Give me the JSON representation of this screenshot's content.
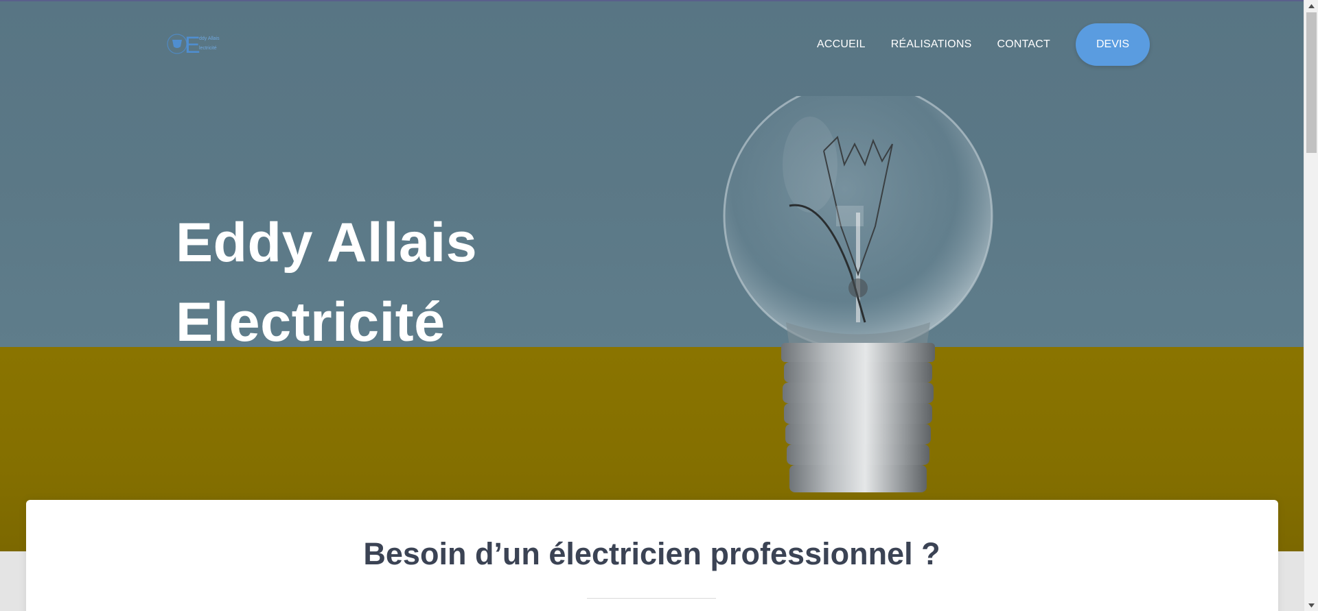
{
  "header": {
    "logo_alt": "Eddy Allais Electricité logo",
    "nav": {
      "accueil": "ACCUEIL",
      "realisations": "RÉALISATIONS",
      "contact": "CONTACT",
      "devis": "DEVIS"
    }
  },
  "hero": {
    "title_line1": "Eddy Allais",
    "title_line2": "Electricité",
    "image": "light-bulb-photo"
  },
  "intro": {
    "title": "Besoin d’un électricien professionnel ?"
  },
  "colors": {
    "accent": "#5a9ce0",
    "heading": "#3b4354",
    "wall": "#5b7886",
    "table": "#857000"
  },
  "icons": [
    "logo-icon",
    "light-bulb-image",
    "scroll-up-icon",
    "scroll-down-icon"
  ]
}
